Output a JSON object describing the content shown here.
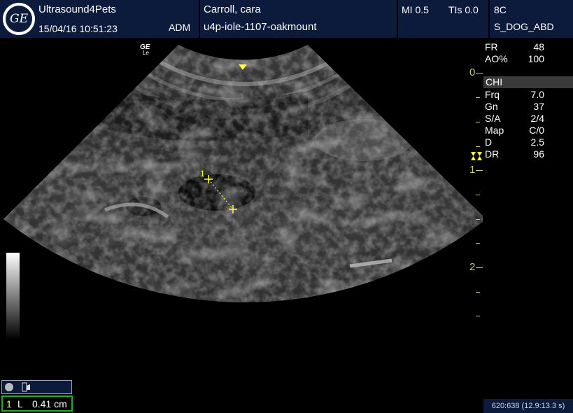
{
  "header": {
    "logo_text": "GE",
    "app_name": "Ultrasound4Pets",
    "datetime": "15/04/16 10:51:23",
    "operator": "ADM",
    "patient_name": "Carroll, cara",
    "patient_id": "u4p-iole-1107-oakmount",
    "mi": "MI 0.5",
    "tis": "TIs 0.0",
    "probe": "8C",
    "preset": "S_DOG_ABD"
  },
  "image": {
    "watermark_line1": "GE",
    "watermark_line2": "Le",
    "caliper_label": "1"
  },
  "params": [
    {
      "key": "FR",
      "value": "48"
    },
    {
      "key": "AO%",
      "value": "100"
    }
  ],
  "mode": "CHI",
  "mode_params": [
    {
      "key": "Frq",
      "value": "7.0"
    },
    {
      "key": "Gn",
      "value": "37"
    },
    {
      "key": "S/A",
      "value": "2/4"
    },
    {
      "key": "Map",
      "value": "C/0"
    },
    {
      "key": "D",
      "value": "2.5"
    },
    {
      "key": "DR",
      "value": "96"
    }
  ],
  "depth_scale": {
    "labels": [
      "0",
      "1",
      "2"
    ]
  },
  "measurement": {
    "index": "1",
    "type": "L",
    "value": "0.41 cm"
  },
  "status": {
    "coords": "620:638  (12.9:13.3 s)"
  },
  "colors": {
    "header_bg": "#0c1a3c",
    "caliper": "#ffff33",
    "scale": "#c8c87a",
    "measurement_border": "#2ca82c"
  },
  "icons": [
    "ge-logo-icon",
    "focus-marker-icon",
    "depth-top-marker-icon",
    "record-icon",
    "pointer-hand-icon"
  ]
}
